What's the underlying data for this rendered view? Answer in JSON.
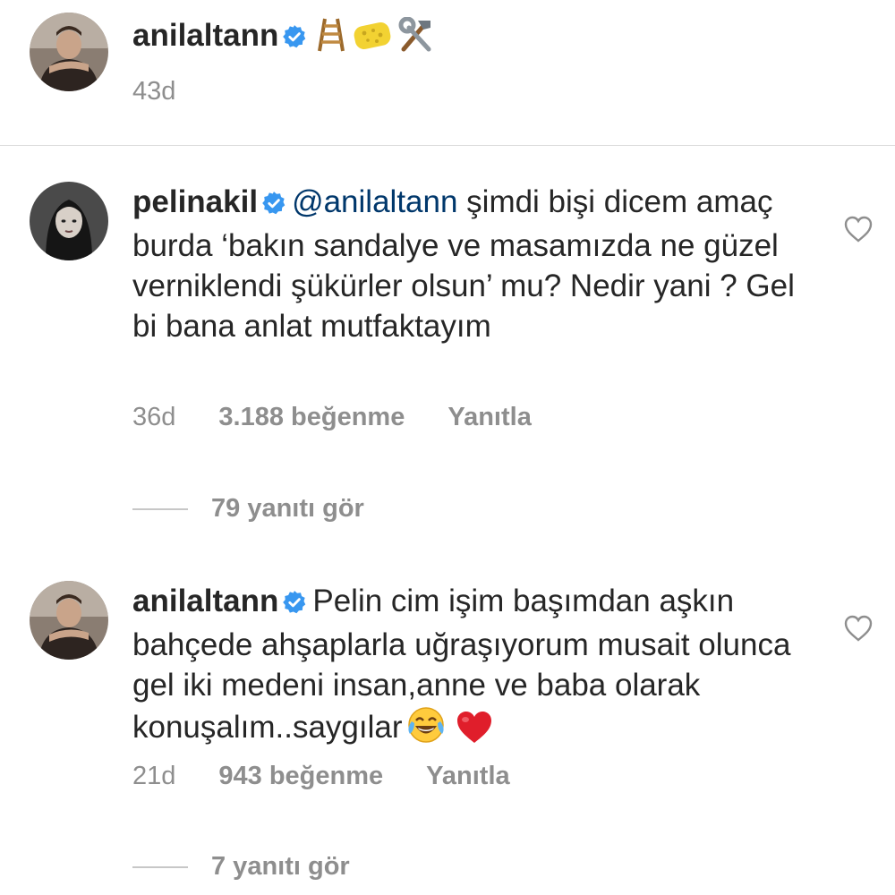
{
  "post": {
    "username": "anilaltann",
    "caption_icons": [
      "ladder-icon",
      "sponge-icon",
      "hammer-wrench-icon"
    ],
    "time": "43d"
  },
  "comments": [
    {
      "username": "pelinakil",
      "mention": "@anilaltann",
      "text": " şimdi bişi dicem amaç burda ‘bakın sandalye ve masamızda ne güzel verniklendi şükürler olsun’ mu? Nedir yani ? Gel bi bana anlat mutfaktayım",
      "time": "36d",
      "likes": "3.188 beğenme",
      "reply_label": "Yanıtla",
      "view_replies": "79 yanıtı gör"
    },
    {
      "username": "anilaltann",
      "text": "Pelin cim işim başımdan aşkın bahçede ahşaplarla uğraşıyorum musait olunca gel iki medeni insan,anne ve baba olarak konuşalım..saygılar",
      "text_icons": [
        "joy-icon",
        "red-heart-icon"
      ],
      "time": "21d",
      "likes": "943 beğenme",
      "reply_label": "Yanıtla",
      "view_replies": "7 yanıtı gör"
    }
  ],
  "colors": {
    "text": "#262626",
    "secondary": "#8e8e8e",
    "mention": "#00376b",
    "verified": "#3897f0",
    "divider": "#dbdbdb"
  }
}
